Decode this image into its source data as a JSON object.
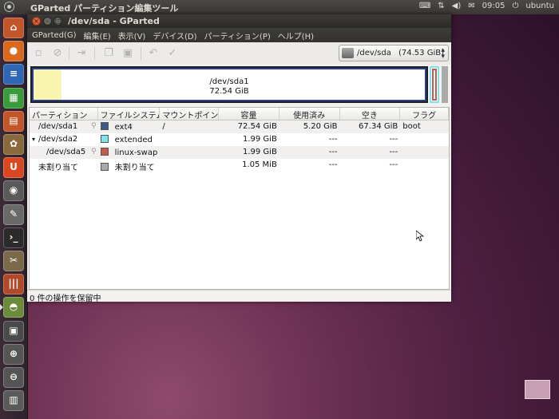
{
  "panel": {
    "app_title": "GParted パーティション編集ツール",
    "clock": "09:05",
    "user": "ubuntu",
    "tray_icons": [
      "keyboard-icon",
      "network-icon",
      "volume-icon",
      "mail-icon"
    ]
  },
  "launcher": {
    "items": [
      {
        "name": "home-folder-icon",
        "color": "#c2552a",
        "glyph": "⌂"
      },
      {
        "name": "firefox-icon",
        "color": "#d86a1f",
        "glyph": "●"
      },
      {
        "name": "writer-icon",
        "color": "#2f67b5",
        "glyph": "≡"
      },
      {
        "name": "calc-icon",
        "color": "#3a9b3a",
        "glyph": "▦"
      },
      {
        "name": "impress-icon",
        "color": "#c2552a",
        "glyph": "▤"
      },
      {
        "name": "software-center-icon",
        "color": "#8a6a3a",
        "glyph": "✿"
      },
      {
        "name": "ubuntu-one-icon",
        "color": "#d8471f",
        "glyph": "U"
      },
      {
        "name": "camera-icon",
        "color": "#5a5a5a",
        "glyph": "◉"
      },
      {
        "name": "text-editor-icon",
        "color": "#6a6a6a",
        "glyph": "✎"
      },
      {
        "name": "terminal-icon",
        "color": "#2b2b2b",
        "glyph": "›_"
      },
      {
        "name": "tools-icon",
        "color": "#7a6a4a",
        "glyph": "✂"
      },
      {
        "name": "pencils-icon",
        "color": "#b04a2a",
        "glyph": "|||"
      },
      {
        "name": "gparted-icon",
        "color": "#6b8a3a",
        "glyph": "◓"
      },
      {
        "name": "workspace-switcher-icon",
        "color": "#4a4a4a",
        "glyph": "▣"
      },
      {
        "name": "lens-apps-icon",
        "color": "#555555",
        "glyph": "⊕"
      },
      {
        "name": "lens-files-icon",
        "color": "#555555",
        "glyph": "⊖"
      },
      {
        "name": "trash-icon",
        "color": "#5a5a5a",
        "glyph": "▥"
      }
    ]
  },
  "window": {
    "title": "/dev/sda - GParted",
    "menu": [
      "GParted(G)",
      "編集(E)",
      "表示(V)",
      "デバイス(D)",
      "パーティション(P)",
      "ヘルプ(H)"
    ],
    "device_selector": {
      "name": "/dev/sda",
      "size": "(74.53 GiB)"
    }
  },
  "visual": {
    "label": "/dev/sda1",
    "size": "72.54 GiB",
    "used_fraction": 0.072
  },
  "table": {
    "headers": [
      "パーティション",
      "ファイルシステム",
      "マウントポイント",
      "容量",
      "使用済み",
      "空き",
      "フラグ"
    ],
    "rows": [
      {
        "partition": "/dev/sda1",
        "expander": "",
        "indent": 0,
        "key": true,
        "fs": "ext4",
        "fs_color": "#3b5a8a",
        "mount": "/",
        "size": "72.54 GiB",
        "used": "5.20 GiB",
        "free": "67.34 GiB",
        "flags": "boot"
      },
      {
        "partition": "/dev/sda2",
        "expander": "▾",
        "indent": 0,
        "key": false,
        "fs": "extended",
        "fs_color": "#7ee4ee",
        "mount": "",
        "size": "1.99 GiB",
        "used": "---",
        "free": "---",
        "flags": ""
      },
      {
        "partition": "/dev/sda5",
        "expander": "",
        "indent": 1,
        "key": true,
        "fs": "linux-swap",
        "fs_color": "#c55a4a",
        "mount": "",
        "size": "1.99 GiB",
        "used": "---",
        "free": "---",
        "flags": ""
      },
      {
        "partition": "未割り当て",
        "expander": "",
        "indent": 0,
        "key": false,
        "fs": "未割り当て",
        "fs_color": "#a9a9a9",
        "mount": "",
        "size": "1.05 MiB",
        "used": "---",
        "free": "---",
        "flags": ""
      }
    ]
  },
  "status": "0 件の操作を保留中"
}
